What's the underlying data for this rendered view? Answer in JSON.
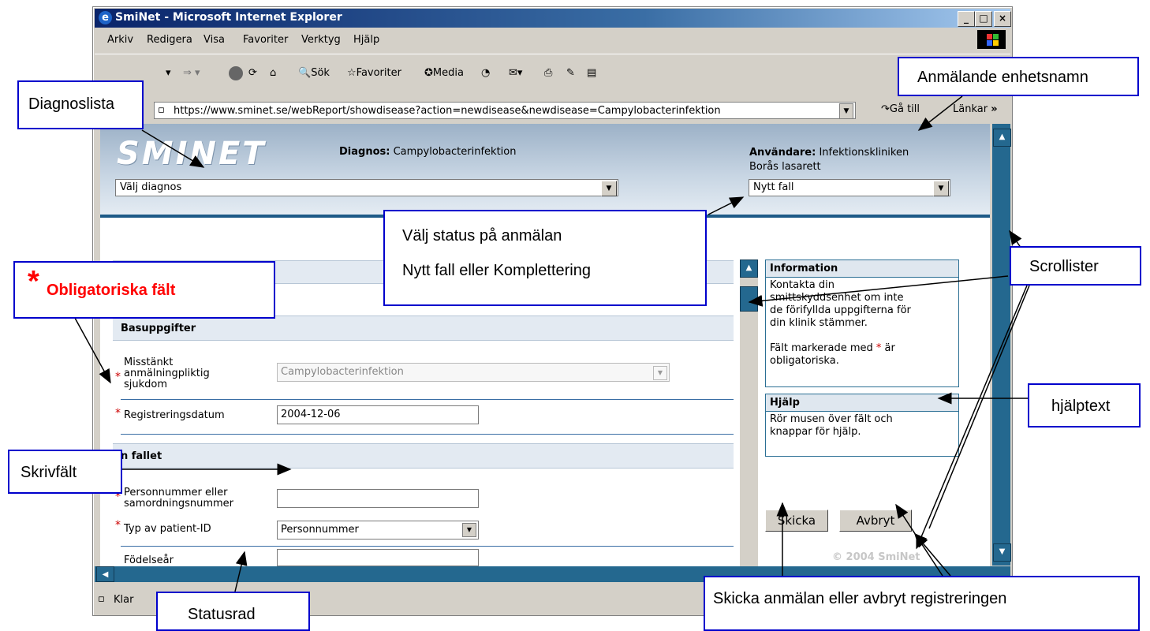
{
  "window": {
    "title": "SmiNet - Microsoft Internet Explorer",
    "controls": [
      "_",
      "□",
      "×"
    ]
  },
  "menu": [
    "Arkiv",
    "Redigera",
    "Visa",
    "Favoriter",
    "Verktyg",
    "Hjälp"
  ],
  "toolbar": {
    "search": "Sök",
    "favorites": "Favoriter",
    "media": "Media"
  },
  "address": {
    "url": "https://www.sminet.se/webReport/showdisease?action=newdisease&newdisease=Campylobacterinfektion",
    "go": "Gå till",
    "links": "Länkar"
  },
  "header": {
    "logo": "SMINET",
    "diagnosis_label": "Diagnos:",
    "diagnosis_value": "Campylobacterinfektion",
    "user_label": "Användare:",
    "user_value_line1": "Infektionskliniken",
    "user_value_line2": "Borås lasarett",
    "diagnosis_select": "Välj diagnos",
    "status_select": "Nytt fall"
  },
  "form": {
    "section_basic": "Basuppgifter",
    "disease_label_lines": [
      "Misstänkt",
      "anmälningpliktig",
      "sjukdom"
    ],
    "disease_value": "Campylobacterinfektion",
    "reg_date_label": "Registreringsdatum",
    "reg_date_value": "2004-12-06",
    "section_case": "n fallet",
    "pnr_label_lines": [
      "Personnummer eller",
      "samordningsnummer"
    ],
    "pnr_value": "",
    "pid_type_label": "Typ av patient-ID",
    "pid_type_value": "Personnummer",
    "birth_year_label": "Födelseår",
    "required_marker": "*"
  },
  "sidebar": {
    "info_title": "Information",
    "info_lines": [
      "Kontakta din",
      "smittskyddsenhet om inte",
      "de förifyllda uppgifterna för",
      "din klinik stämmer."
    ],
    "required_note_pre": "Fält markerade med",
    "required_note_star": "*",
    "required_note_post": "är",
    "required_note_line2": "obligatoriska.",
    "help_title": "Hjälp",
    "help_lines": [
      "Rör musen över fält och",
      "knappar för hjälp."
    ],
    "send_button": "Skicka",
    "cancel_button": "Avbryt",
    "copyright": "© 2004 SmiNet"
  },
  "status": {
    "text": "Klar"
  },
  "annotations": {
    "diagnoslista": "Diagnoslista",
    "unit_name": "Anmälande enhetsnamn",
    "status_line1": "Välj status på anmälan",
    "status_line2": "Nytt fall eller Komplettering",
    "mandatory_star": "*",
    "mandatory": "Obligatoriska fält",
    "scroll": "Scrollister",
    "helptext": "hjälptext",
    "textfield": "Skrivfält",
    "statusbar": "Statusrad",
    "send_cancel": "Skicka anmälan eller avbryt registreringen"
  },
  "colors": {
    "accent": "#1d5a87",
    "annotation_border": "#0000cc",
    "mandatory": "#ff0000"
  }
}
